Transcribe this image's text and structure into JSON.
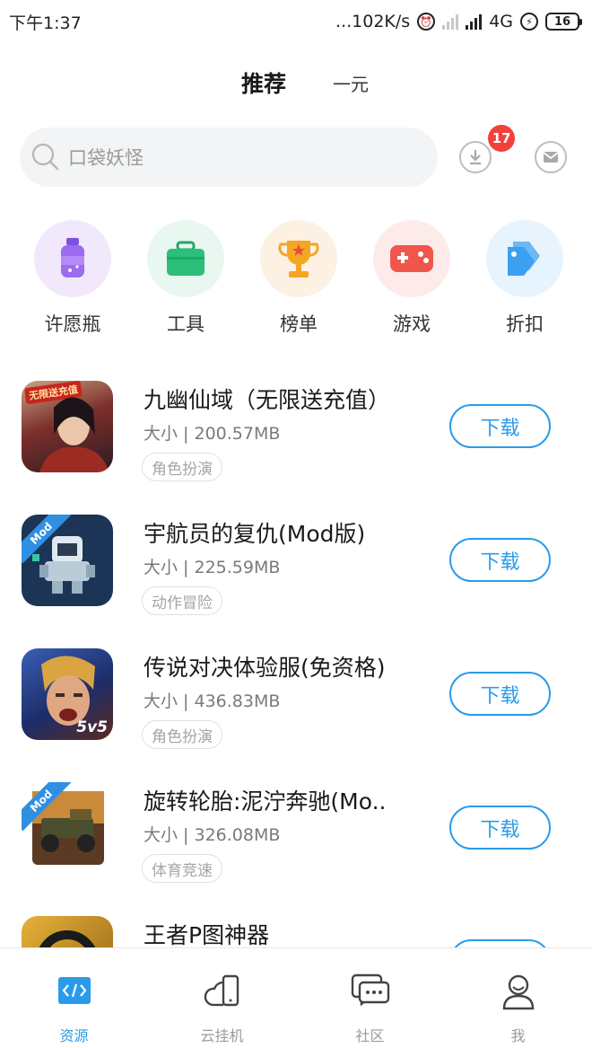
{
  "status_bar": {
    "time": "下午1:37",
    "speed": "...102K/s",
    "network": "4G",
    "battery": "16"
  },
  "top_tabs": {
    "active": "推荐",
    "other": "一元"
  },
  "search": {
    "placeholder": "口袋妖怪",
    "download_badge": "17"
  },
  "categories": [
    {
      "label": "许愿瓶",
      "icon": "wish-bottle-icon",
      "bg": "#f1e9fb",
      "color": "#9b6bf2"
    },
    {
      "label": "工具",
      "icon": "toolbox-icon",
      "bg": "#e8f7ef",
      "color": "#2bbf7a"
    },
    {
      "label": "榜单",
      "icon": "trophy-icon",
      "bg": "#fdf1e3",
      "color": "#f5a623"
    },
    {
      "label": "游戏",
      "icon": "gamepad-icon",
      "bg": "#fdebea",
      "color": "#f0564c"
    },
    {
      "label": "折扣",
      "icon": "discount-tag-icon",
      "bg": "#e7f3fd",
      "color": "#3d9ff0"
    }
  ],
  "apps": [
    {
      "name": "九幽仙域（无限送充值）",
      "size": "大小 | 200.57MB",
      "tag": "角色扮演",
      "button": "下载",
      "thumb_banner": "无限送充值"
    },
    {
      "name": "宇航员的复仇(Mod版)",
      "size": "大小 | 225.59MB",
      "tag": "动作冒险",
      "button": "下载",
      "ribbon": "Mod"
    },
    {
      "name": "传说对决体验服(免资格)",
      "size": "大小 | 436.83MB",
      "tag": "角色扮演",
      "button": "下载",
      "thumb_text": "5v5"
    },
    {
      "name": "旋转轮胎:泥泞奔驰(Mo..",
      "size": "大小 | 326.08MB",
      "tag": "体育竞速",
      "button": "下载",
      "ribbon": "Mod"
    },
    {
      "name": "王者P图神器",
      "size": "",
      "tag": "",
      "button": ""
    }
  ],
  "bottom_nav": [
    {
      "label": "资源",
      "icon": "code-resource-icon",
      "active": true
    },
    {
      "label": "云挂机",
      "icon": "cloud-phone-icon",
      "active": false
    },
    {
      "label": "社区",
      "icon": "chat-bubbles-icon",
      "active": false
    },
    {
      "label": "我",
      "icon": "user-profile-icon",
      "active": false
    }
  ],
  "colors": {
    "accent": "#2a9bea",
    "badge": "#f2413b"
  }
}
